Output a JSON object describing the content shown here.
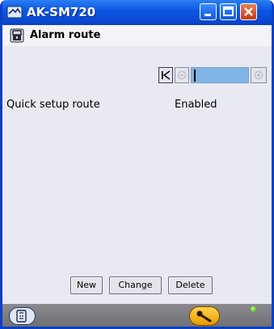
{
  "window": {
    "title": "AK-SM720",
    "icon": "app-icon"
  },
  "header": {
    "title": "Alarm route",
    "icon": "lock-icon"
  },
  "navigation": {
    "first_icon": "first-page-icon",
    "prev_icon": "previous-icon",
    "next_icon": "next-icon",
    "field_value": ""
  },
  "rows": [
    {
      "label": "Quick setup route",
      "value": "Enabled"
    }
  ],
  "buttons": {
    "new_label": "New",
    "change_label": "Change",
    "delete_label": "Delete"
  },
  "footer": {
    "left_icon": "tree-icon",
    "right_icon": "key-icon",
    "status_color": "#37b000"
  },
  "colors": {
    "titlebar": "#0a55e0",
    "nav_field": "#7fb4e6",
    "background": "#e9e9f1"
  }
}
